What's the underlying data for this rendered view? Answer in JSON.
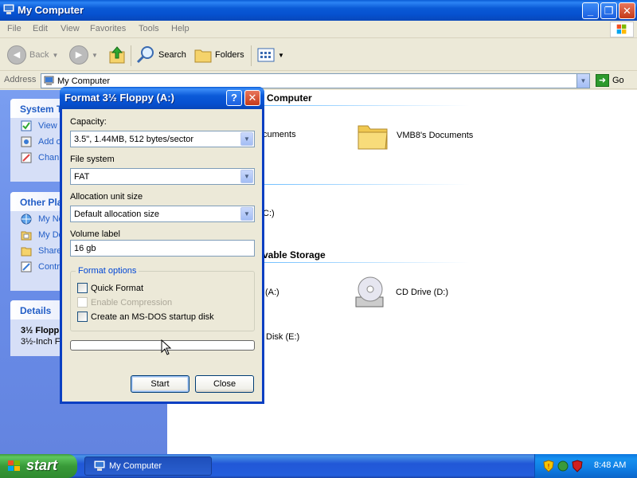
{
  "window": {
    "title": "My Computer",
    "menu": [
      "File",
      "Edit",
      "View",
      "Favorites",
      "Tools",
      "Help"
    ],
    "toolbar": {
      "back": "Back",
      "search": "Search",
      "folders": "Folders"
    },
    "address": {
      "label": "Address",
      "value": "My Computer",
      "go": "Go"
    }
  },
  "leftpane": {
    "system_tasks": {
      "title": "System T",
      "items": [
        "View s",
        "Add o",
        "Chan"
      ]
    },
    "other_places": {
      "title": "Other Pla",
      "items": [
        "My Ne",
        "My Do",
        "Share",
        "Contr"
      ]
    },
    "details": {
      "title": "Details",
      "name": "3½ Flopp",
      "desc": "3½-Inch F"
    }
  },
  "content": {
    "group1_title": "Computer",
    "group1_items": [
      "cuments",
      "VMB8's Documents"
    ],
    "group2_partial": "C:)",
    "group3_title": "vable Storage",
    "group3_items": [
      "(A:)",
      "CD Drive (D:)",
      "Disk (E:)"
    ]
  },
  "dialog": {
    "title": "Format 3½ Floppy (A:)",
    "capacity_label": "Capacity:",
    "capacity_value": "3.5\",  1.44MB, 512 bytes/sector",
    "filesystem_label": "File system",
    "filesystem_value": "FAT",
    "allocation_label": "Allocation unit size",
    "allocation_value": "Default allocation size",
    "volume_label": "Volume label",
    "volume_value": "16 gb",
    "format_options_title": "Format options",
    "options": [
      {
        "label": "Quick Format",
        "checked": false,
        "enabled": true
      },
      {
        "label": "Enable Compression",
        "checked": false,
        "enabled": false
      },
      {
        "label": "Create an MS-DOS startup disk",
        "checked": false,
        "enabled": true
      }
    ],
    "progress": 0,
    "start_label": "Start",
    "close_label": "Close"
  },
  "taskbar": {
    "start_label": "start",
    "task_label": "My Computer",
    "clock": "8:48 AM"
  },
  "colors": {
    "title_blue": "#0a5ad6",
    "taskbar_blue": "#245edc",
    "start_green": "#389a38",
    "link_blue": "#215dc6"
  }
}
